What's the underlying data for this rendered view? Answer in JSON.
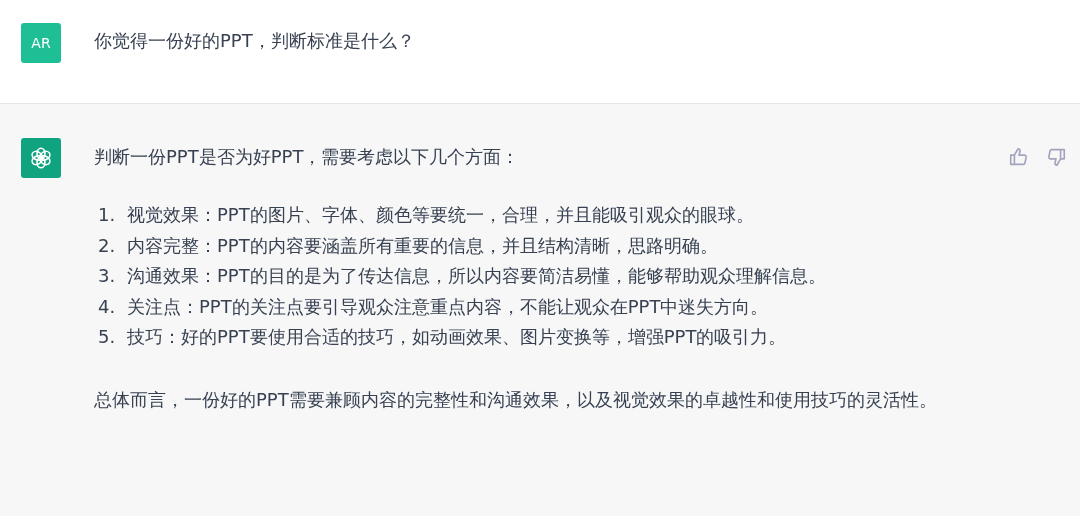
{
  "messages": [
    {
      "kind": "user",
      "avatar": "AR",
      "text": "你觉得一份好的PPT，判断标准是什么？"
    },
    {
      "kind": "assistant",
      "intro": "判断一份PPT是否为好PPT，需要考虑以下几个方面：",
      "items": [
        {
          "number": "1.",
          "text": "视觉效果：PPT的图片、字体、颜色等要统一，合理，并且能吸引观众的眼球。"
        },
        {
          "number": "2.",
          "text": "内容完整：PPT的内容要涵盖所有重要的信息，并且结构清晰，思路明确。"
        },
        {
          "number": "3.",
          "text": "沟通效果：PPT的目的是为了传达信息，所以内容要简洁易懂，能够帮助观众理解信息。"
        },
        {
          "number": "4.",
          "text": "关注点：PPT的关注点要引导观众注意重点内容，不能让观众在PPT中迷失方向。"
        },
        {
          "number": "5.",
          "text": "技巧：好的PPT要使用合适的技巧，如动画效果、图片变换等，增强PPT的吸引力。"
        }
      ],
      "summary": "总体而言，一份好的PPT需要兼顾内容的完整性和沟通效果，以及视觉效果的卓越性和使用技巧的灵活性。"
    }
  ]
}
